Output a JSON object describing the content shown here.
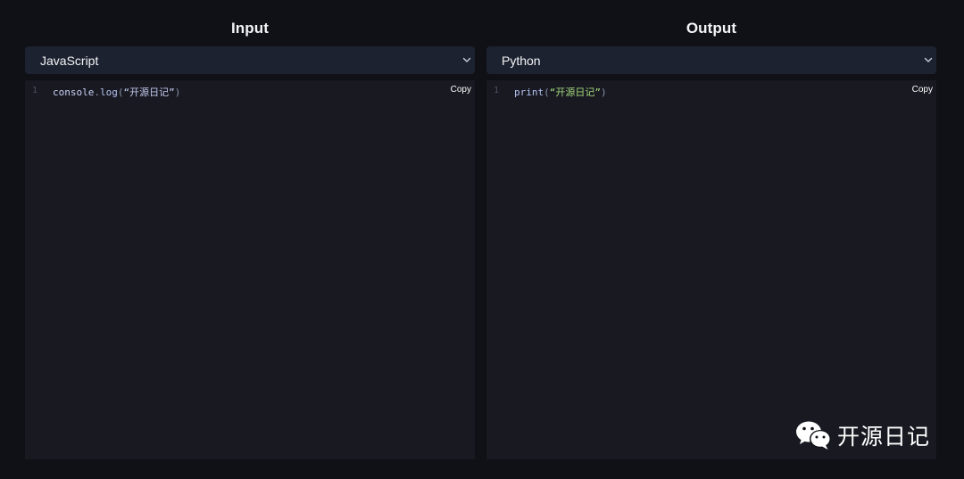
{
  "input_pane": {
    "title": "Input",
    "language": "JavaScript",
    "copy_label": "Copy",
    "line_number": "1",
    "code": {
      "obj": "console",
      "dot": ".",
      "method": "log",
      "open_paren": "(",
      "string": "“开源日记”",
      "close_paren": ")"
    }
  },
  "output_pane": {
    "title": "Output",
    "language": "Python",
    "copy_label": "Copy",
    "line_number": "1",
    "code": {
      "fn": "print",
      "open_paren": "(",
      "string": "“开源日记”",
      "close_paren": ")"
    }
  },
  "watermark": {
    "text": "开源日记",
    "icon": "wechat-icon"
  },
  "colors": {
    "background": "#0f1116",
    "select_bg": "#1d2230",
    "editor_bg": "#181921",
    "string_output": "#a3d97c"
  }
}
